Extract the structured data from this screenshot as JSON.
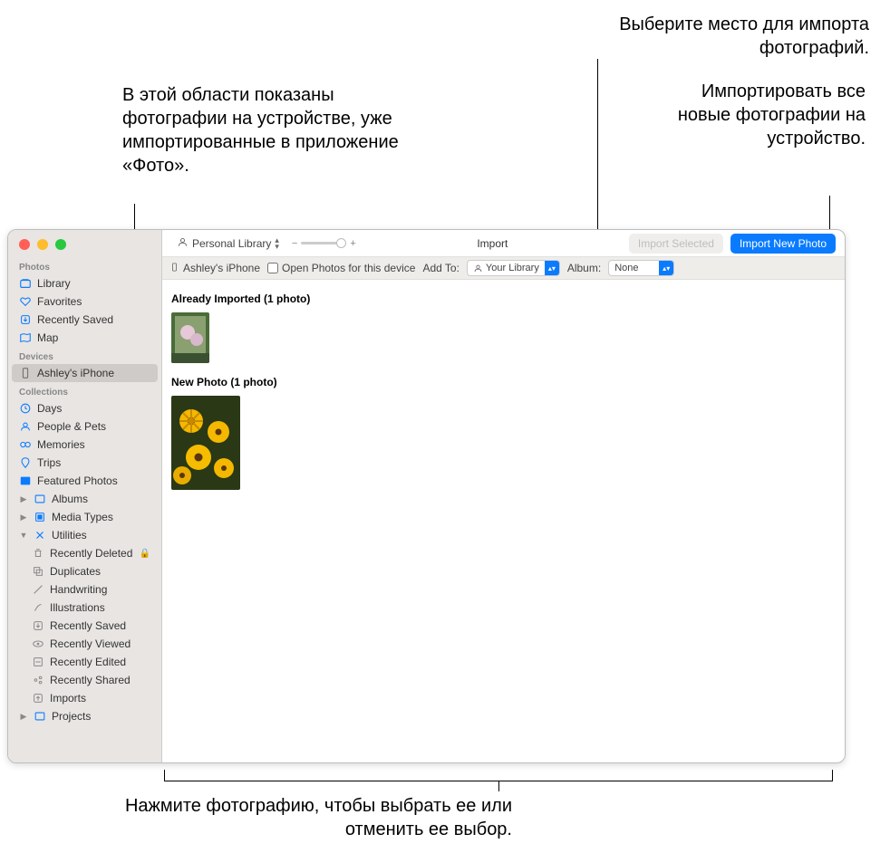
{
  "annotations": {
    "top_left": "В этой области показаны фотографии на устройстве, уже импортированные в приложение «Фото».",
    "top_right_1": "Выберите место для импорта фотографий.",
    "top_right_2": "Импортировать все новые фотографии на устройство.",
    "bottom": "Нажмите фотографию, чтобы выбрать ее или отменить ее выбор."
  },
  "toolbar": {
    "library_dropdown": "Personal Library",
    "slider_minus": "−",
    "slider_plus": "+",
    "title": "Import",
    "import_selected": "Import Selected",
    "import_new": "Import New Photo"
  },
  "subbar": {
    "device": "Ashley's iPhone",
    "checkbox_label": "Open Photos for this device",
    "addto_label": "Add To:",
    "addto_value": "Your Library",
    "album_label": "Album:",
    "album_value": "None"
  },
  "sections": {
    "already": "Already Imported (1 photo)",
    "newp": "New Photo (1 photo)"
  },
  "sidebar": {
    "photos_hdr": "Photos",
    "library": "Library",
    "favorites": "Favorites",
    "recently_saved": "Recently Saved",
    "map": "Map",
    "devices_hdr": "Devices",
    "device": "Ashley's iPhone",
    "collections_hdr": "Collections",
    "days": "Days",
    "people": "People & Pets",
    "memories": "Memories",
    "trips": "Trips",
    "featured": "Featured Photos",
    "albums": "Albums",
    "media_types": "Media Types",
    "utilities": "Utilities",
    "recently_deleted": "Recently Deleted",
    "duplicates": "Duplicates",
    "handwriting": "Handwriting",
    "illustrations": "Illustrations",
    "u_recently_saved": "Recently Saved",
    "recently_viewed": "Recently Viewed",
    "recently_edited": "Recently Edited",
    "recently_shared": "Recently Shared",
    "imports": "Imports",
    "projects": "Projects"
  }
}
